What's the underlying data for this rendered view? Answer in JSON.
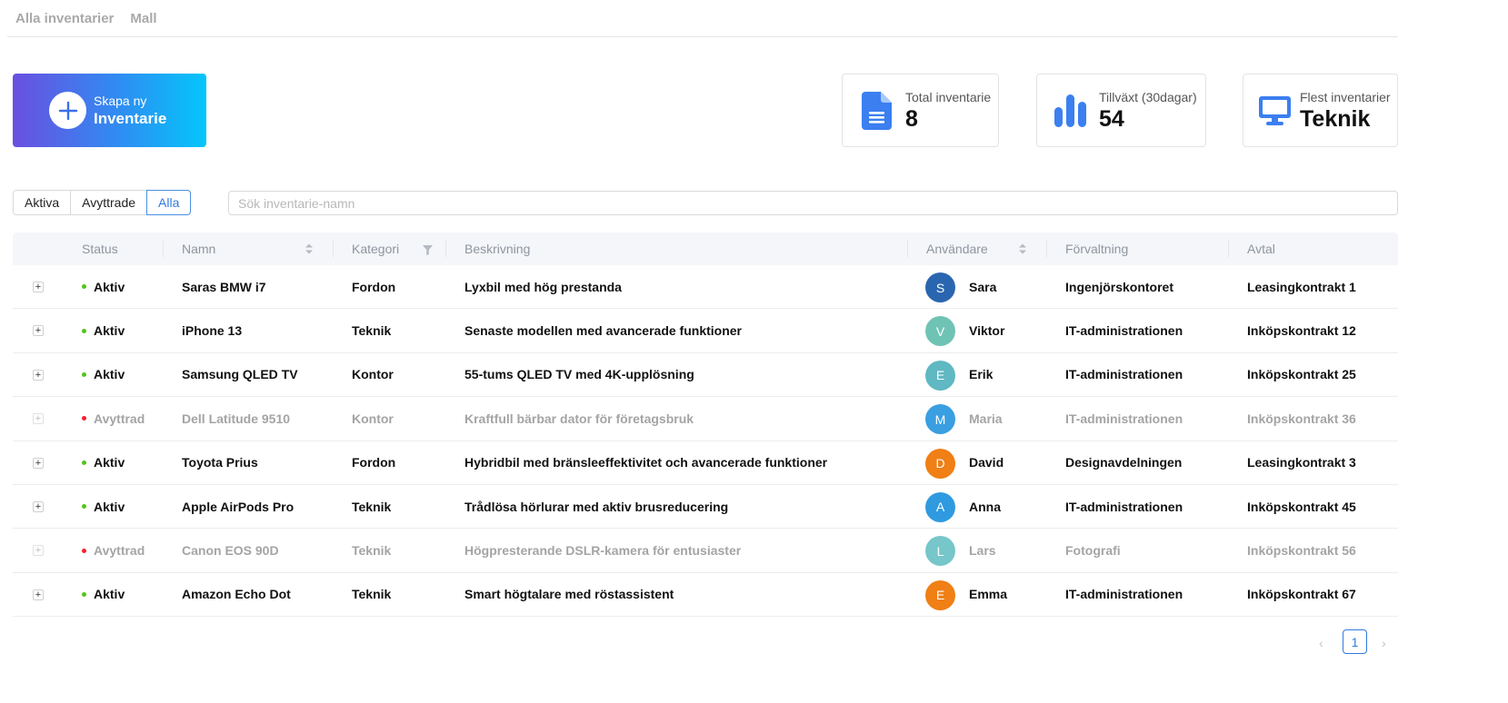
{
  "top_tabs": [
    "Alla inventarier",
    "Mall"
  ],
  "create": {
    "small": "Skapa ny",
    "big": "Inventarie",
    "icon": "plus-icon"
  },
  "stats": [
    {
      "label": "Total inventarie",
      "value": "8",
      "icon": "document-icon",
      "color": "#3b7ff0"
    },
    {
      "label": "Tillväxt (30dagar)",
      "value": "54",
      "icon": "bar-chart-icon",
      "color": "#3b7ff0"
    },
    {
      "label": "Flest inventarier",
      "value": "Teknik",
      "icon": "monitor-icon",
      "color": "#3b7ff0"
    }
  ],
  "filters": {
    "options": [
      "Aktiva",
      "Avyttrade",
      "Alla"
    ],
    "selected": "Alla"
  },
  "search": {
    "placeholder": "Sök inventarie-namn",
    "value": ""
  },
  "table": {
    "columns": [
      "Status",
      "Namn",
      "Kategori",
      "Beskrivning",
      "Användare",
      "Förvaltning",
      "Avtal"
    ],
    "rows": [
      {
        "status": "Aktiv",
        "name": "Saras BMW i7",
        "category": "Fordon",
        "description": "Lyxbil med hög prestanda",
        "initial": "S",
        "user": "Sara",
        "avatar_color": "#2a66b0",
        "department": "Ingenjörskontoret",
        "contract": "Leasingkontrakt 1"
      },
      {
        "status": "Aktiv",
        "name": "iPhone 13",
        "category": "Teknik",
        "description": "Senaste modellen med avancerade funktioner",
        "initial": "V",
        "user": "Viktor",
        "avatar_color": "#6fc3b5",
        "department": "IT-administrationen",
        "contract": "Inköpskontrakt 12"
      },
      {
        "status": "Aktiv",
        "name": "Samsung QLED TV",
        "category": "Kontor",
        "description": "55-tums QLED TV med 4K-upplösning",
        "initial": "E",
        "user": "Erik",
        "avatar_color": "#5fb8c2",
        "department": "IT-administrationen",
        "contract": "Inköpskontrakt 25"
      },
      {
        "status": "Avyttrad",
        "name": "Dell Latitude 9510",
        "category": "Kontor",
        "description": "Kraftfull bärbar dator för företagsbruk",
        "initial": "M",
        "user": "Maria",
        "avatar_color": "#2f9ae0",
        "department": "IT-administrationen",
        "contract": "Inköpskontrakt 36"
      },
      {
        "status": "Aktiv",
        "name": "Toyota Prius",
        "category": "Fordon",
        "description": "Hybridbil med bränsleeffektivitet och avancerade funktioner",
        "initial": "D",
        "user": "David",
        "avatar_color": "#f07f15",
        "department": "Designavdelningen",
        "contract": "Leasingkontrakt 3"
      },
      {
        "status": "Aktiv",
        "name": "Apple AirPods Pro",
        "category": "Teknik",
        "description": "Trådlösa hörlurar med aktiv brusreducering",
        "initial": "A",
        "user": "Anna",
        "avatar_color": "#2f9ae0",
        "department": "IT-administrationen",
        "contract": "Inköpskontrakt 45"
      },
      {
        "status": "Avyttrad",
        "name": "Canon EOS 90D",
        "category": "Teknik",
        "description": "Högpresterande DSLR-kamera för entusiaster",
        "initial": "L",
        "user": "Lars",
        "avatar_color": "#6fc3c8",
        "department": "Fotografi",
        "contract": "Inköpskontrakt 56"
      },
      {
        "status": "Aktiv",
        "name": "Amazon Echo Dot",
        "category": "Teknik",
        "description": "Smart högtalare med röstassistent",
        "initial": "E",
        "user": "Emma",
        "avatar_color": "#f07f15",
        "department": "IT-administrationen",
        "contract": "Inköpskontrakt 67"
      }
    ]
  },
  "status_colors": {
    "Aktiv": "#52c41a",
    "Avyttrad": "#f5222d"
  },
  "pagination": {
    "current": "1",
    "prev_icon": "chevron-left-icon",
    "next_icon": "chevron-right-icon"
  }
}
